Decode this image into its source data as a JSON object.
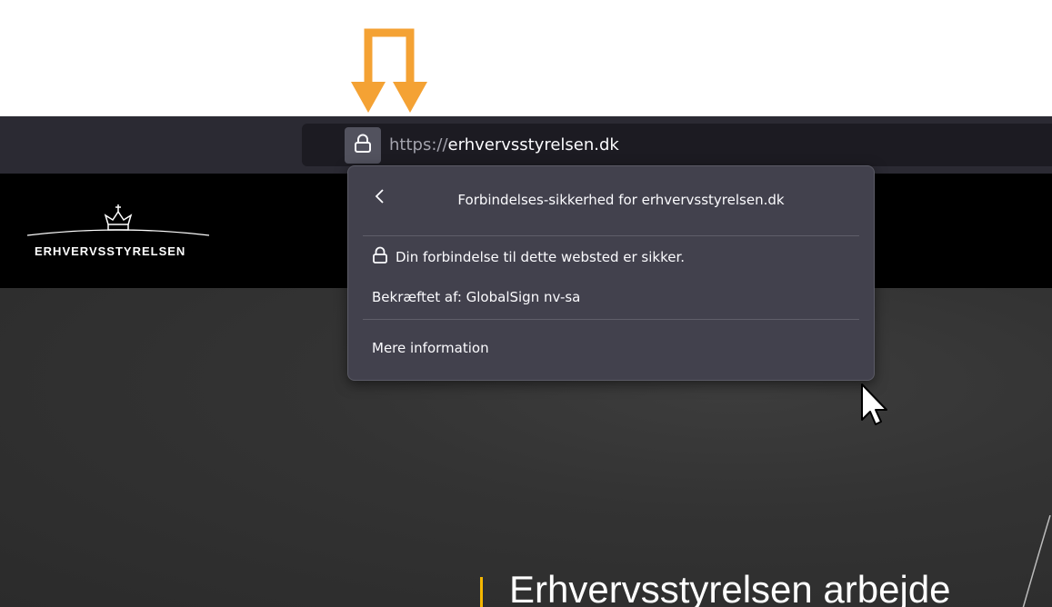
{
  "address_bar": {
    "url_scheme": "https://",
    "url_host": "erhvervsstyrelsen.dk",
    "lock_icon": "lock-icon"
  },
  "site": {
    "logo_text": "Erhvervsstyrelsen",
    "hero_title": "Erhvervsstyrelsen arbejde"
  },
  "security_panel": {
    "back_icon": "chevron-left-icon",
    "title": "Forbindelses-sikkerhed for erhvervsstyrelsen.dk",
    "secure_text": "Din forbindelse til dette websted er sikker.",
    "verified_by": "Bekræftet af: GlobalSign nv-sa",
    "more_info": "Mere information"
  },
  "colors": {
    "annotation_arrow": "#f4a234",
    "accent_line": "#f5b700",
    "panel_bg": "#42414d",
    "toolbar_bg": "#2b2a33"
  }
}
